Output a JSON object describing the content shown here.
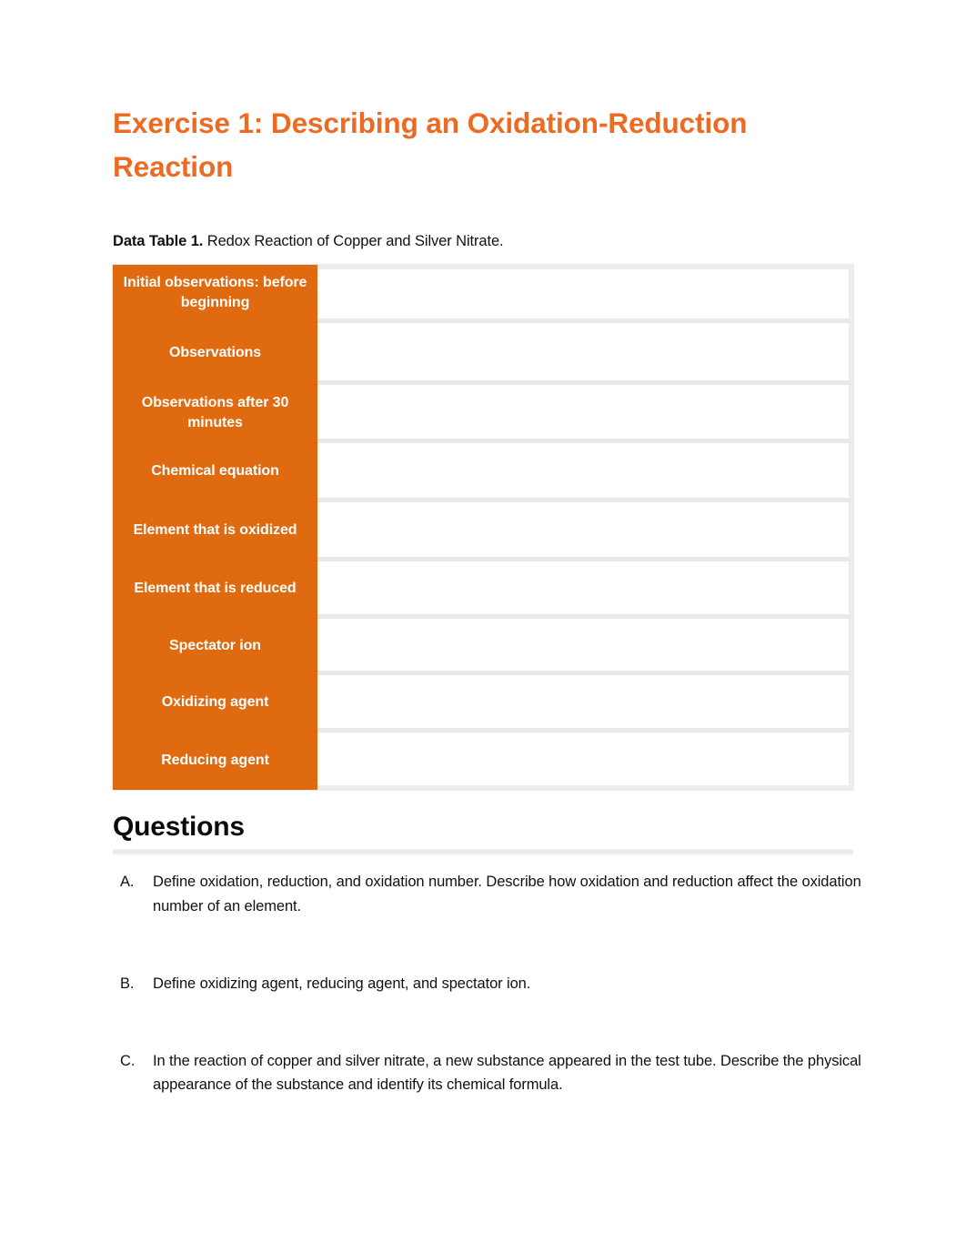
{
  "document": {
    "title": "Exercise 1: Describing an Oxidation-Reduction Reaction",
    "title_color": "#ED6A23"
  },
  "table_caption": {
    "lead": "Data Table 1.",
    "rest": " Redox Reaction of Copper and Silver Nitrate."
  },
  "data_table": {
    "header_color": "#E06A10",
    "rows": [
      {
        "label": "Initial observations: before beginning",
        "value": ""
      },
      {
        "label": "Observations",
        "value": ""
      },
      {
        "label": "Observations after 30 minutes",
        "value": ""
      },
      {
        "label": "Chemical equation",
        "value": ""
      },
      {
        "label": "Element that is oxidized",
        "value": ""
      },
      {
        "label": "Element that is reduced",
        "value": ""
      },
      {
        "label": "Spectator ion",
        "value": ""
      },
      {
        "label": "Oxidizing agent",
        "value": ""
      },
      {
        "label": "Reducing agent",
        "value": ""
      }
    ]
  },
  "questions": {
    "heading": "Questions",
    "items": [
      {
        "marker": "A.",
        "text": "Define oxidation, reduction, and oxidation number. Describe how oxidation and reduction affect the oxidation number of an element."
      },
      {
        "marker": "B.",
        "text": "Define oxidizing agent, reducing agent, and spectator ion."
      },
      {
        "marker": "C.",
        "text": "In the reaction of copper and silver nitrate, a new substance appeared in the test tube. Describe the physical appearance of the substance and identify its chemical formula."
      }
    ]
  }
}
